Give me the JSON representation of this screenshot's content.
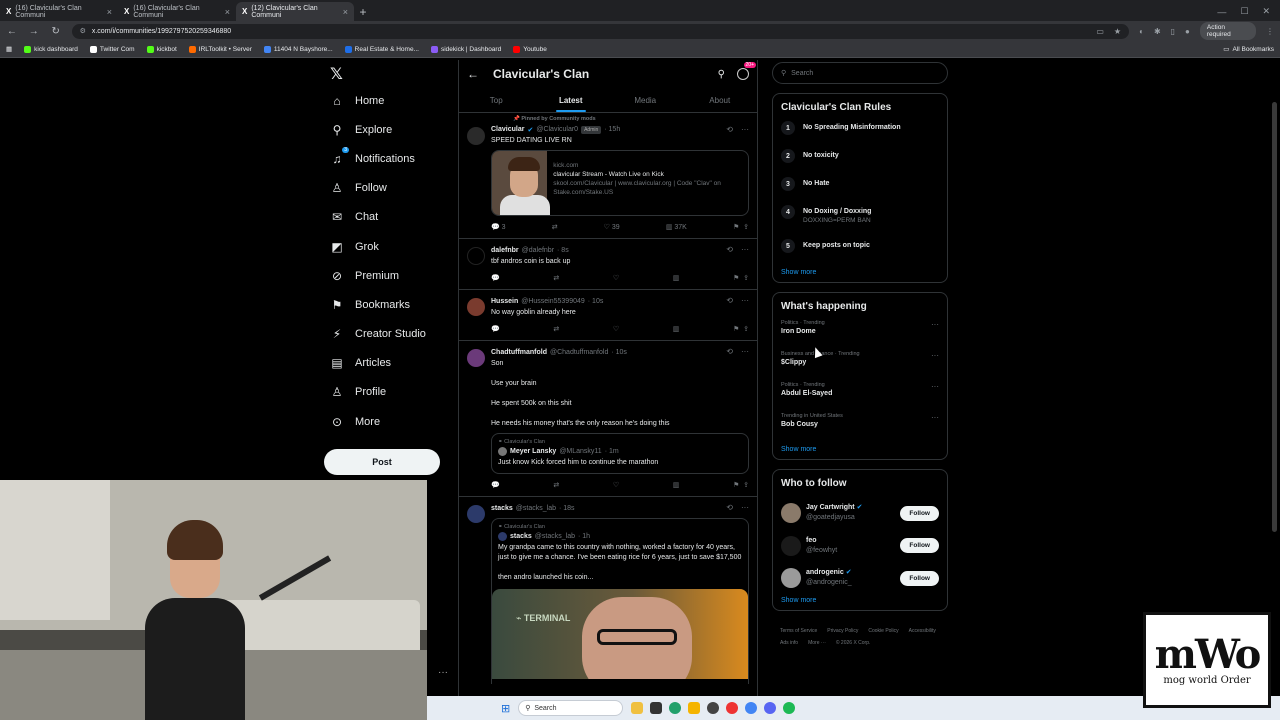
{
  "browser": {
    "tabs": [
      {
        "label": "(16) Clavicular's Clan Communi",
        "active": false
      },
      {
        "label": "(16) Clavicular's Clan Communi",
        "active": false
      },
      {
        "label": "(12) Clavicular's Clan Communi",
        "active": true
      }
    ],
    "url": "x.com/i/communities/1992797520259346880",
    "action_required": "Action required",
    "bookmarks": [
      {
        "label": "kick dashboard",
        "color": "#53fc18"
      },
      {
        "label": "Twitter Com",
        "color": "#ffffff"
      },
      {
        "label": "kickbot",
        "color": "#53fc18"
      },
      {
        "label": "IRLToolkit • Server",
        "color": "#ff6a00"
      },
      {
        "label": "11404 N Bayshore...",
        "color": "#4285f4"
      },
      {
        "label": "Real Estate & Home...",
        "color": "#1e6ee8"
      },
      {
        "label": "sidekick | Dashboard",
        "color": "#8b5cf6"
      },
      {
        "label": "Youtube",
        "color": "#ff0000"
      }
    ],
    "all_bookmarks": "All Bookmarks"
  },
  "nav": {
    "items": [
      {
        "label": "Home",
        "icon": "home-icon",
        "glyph": "⌂"
      },
      {
        "label": "Explore",
        "icon": "search-icon",
        "glyph": "⚲"
      },
      {
        "label": "Notifications",
        "icon": "bell-icon",
        "glyph": "♫"
      },
      {
        "label": "Follow",
        "icon": "follow-icon",
        "glyph": "♙"
      },
      {
        "label": "Chat",
        "icon": "mail-icon",
        "glyph": "✉"
      },
      {
        "label": "Grok",
        "icon": "grok-icon",
        "glyph": "◩"
      },
      {
        "label": "Premium",
        "icon": "premium-icon",
        "glyph": "⊘"
      },
      {
        "label": "Bookmarks",
        "icon": "bookmark-icon",
        "glyph": "⚑"
      },
      {
        "label": "Creator Studio",
        "icon": "creator-studio-icon",
        "glyph": "⚡"
      },
      {
        "label": "Articles",
        "icon": "articles-icon",
        "glyph": "▤"
      },
      {
        "label": "Profile",
        "icon": "profile-icon",
        "glyph": "♙"
      },
      {
        "label": "More",
        "icon": "more-icon",
        "glyph": "⊙"
      }
    ],
    "notif_count": "3",
    "post_label": "Post"
  },
  "community": {
    "title": "Clavicular's Clan",
    "badge": "20+",
    "tabs": [
      "Top",
      "Latest",
      "Media",
      "About"
    ],
    "active_tab": "Latest"
  },
  "tweets": {
    "pinned_label": "Pinned by Community mods",
    "t1": {
      "name": "Clavicular",
      "handle": "@Clavicular0",
      "badge": "Admin",
      "time": "· 15h",
      "text": "SPEED DATING LIVE RN",
      "card_domain": "kick.com",
      "card_title": "clavicular Stream - Watch Live on Kick",
      "card_desc": "skool.com/Clavicular | www.clavicular.org | Code \"Clav\" on Stake.com/Stake.US",
      "replies": "3",
      "likes": "39",
      "views": "37K"
    },
    "t2": {
      "name": "dalefnbr",
      "handle": "@dalefnbr",
      "time": "· 8s",
      "text": "tbf andros coin is back up"
    },
    "t3": {
      "name": "Hussein",
      "handle": "@Hussein55399049",
      "time": "· 10s",
      "text": "No way goblin already here"
    },
    "t4": {
      "name": "Chadtuffmanfold",
      "handle": "@Chadtuffmanfold",
      "time": "· 10s",
      "lines": [
        "Son",
        "Use your brain",
        "He spent 500k on this shit",
        "He needs his money that's the only reason he's doing this"
      ],
      "quote_comm": "Clavicular's Clan",
      "quote_name": "Meyer Lansky",
      "quote_handle": "@MLansky11",
      "quote_time": "· 1m",
      "quote_text": "Just know Kick forced him to continue the marathon"
    },
    "t5": {
      "name": "stacks",
      "handle": "@stacks_lab",
      "time": "· 18s",
      "quote_comm": "Clavicular's Clan",
      "quote_name": "stacks",
      "quote_handle": "@stacks_lab",
      "quote_time": "· 1h",
      "quote_text": "My grandpa came to this country with nothing, worked a factory for 40 years, just to give me a chance. I've been eating rice for 6 years, just to save $17,500",
      "quote_text2": "then andro launched his coin...",
      "image_label": "TERMINAL"
    }
  },
  "right": {
    "search_placeholder": "Search",
    "rules_title": "Clavicular's Clan Rules",
    "rules": [
      {
        "num": "1",
        "title": "No Spreading Misinformation",
        "sub": ""
      },
      {
        "num": "2",
        "title": "No toxicity",
        "sub": ""
      },
      {
        "num": "3",
        "title": "No Hate",
        "sub": ""
      },
      {
        "num": "4",
        "title": "No Doxing / Doxxing",
        "sub": "DOXXING=PERM BAN"
      },
      {
        "num": "5",
        "title": "Keep posts on topic",
        "sub": ""
      }
    ],
    "show_more": "Show more",
    "happening_title": "What's happening",
    "trends": [
      {
        "cat": "Politics · Trending",
        "name": "Iron Dome"
      },
      {
        "cat": "Business and finance · Trending",
        "name": "$Clippy"
      },
      {
        "cat": "Politics · Trending",
        "name": "Abdul El-Sayed"
      },
      {
        "cat": "Trending in United States",
        "name": "Bob Cousy"
      }
    ],
    "wtf_title": "Who to follow",
    "follows": [
      {
        "name": "Jay Cartwright",
        "handle": "@goatedjayusa",
        "verified": true
      },
      {
        "name": "feo",
        "handle": "@feowhyt",
        "verified": false
      },
      {
        "name": "androgenic",
        "handle": "@androgenic_",
        "verified": true
      }
    ],
    "follow_label": "Follow",
    "footer": [
      "Terms of Service",
      "Privacy Policy",
      "Cookie Policy",
      "Accessibility",
      "Ads info",
      "More ···",
      "© 2026 X Corp."
    ]
  },
  "taskbar": {
    "search": "Search"
  },
  "logo": {
    "main": "mWo",
    "sub": "mog world Order"
  }
}
